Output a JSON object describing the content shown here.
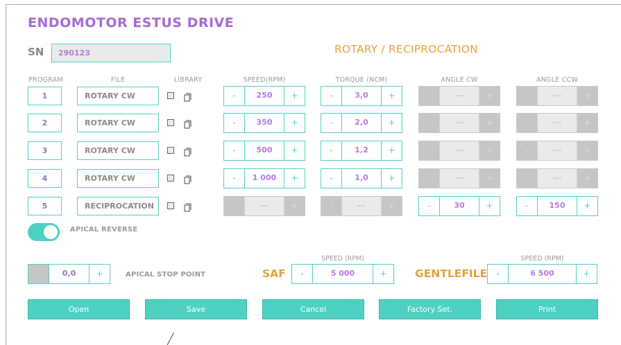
{
  "title": "ENDOMOTOR ESTUS DRIVE",
  "sn": {
    "label": "SN",
    "value": "290123"
  },
  "mode_title": "ROTARY / RECIPROCATION",
  "columns": {
    "program": "PROGRAM",
    "file": "FILE",
    "library": "LIBRARY",
    "speed": "SPEED(RPM)",
    "torque": "TORQUE (NCM)",
    "angle_cw": "ANGLE CW",
    "angle_ccw": "ANGLE CCW"
  },
  "stepper_minus": "-",
  "stepper_plus": "+",
  "programs": [
    {
      "num": "1",
      "file": "ROTARY CW",
      "speed": "250",
      "torque": "3,0",
      "angle_cw": "---",
      "angle_ccw": "---"
    },
    {
      "num": "2",
      "file": "ROTARY CW",
      "speed": "350",
      "torque": "2,0",
      "angle_cw": "---",
      "angle_ccw": "---"
    },
    {
      "num": "3",
      "file": "ROTARY CW",
      "speed": "500",
      "torque": "1,2",
      "angle_cw": "---",
      "angle_ccw": "---"
    },
    {
      "num": "4",
      "file": "ROTARY CW",
      "speed": "1 000",
      "torque": "1,0",
      "angle_cw": "---",
      "angle_ccw": "---"
    },
    {
      "num": "5",
      "file": "RECIPROCATION",
      "speed": "---",
      "torque": "---",
      "angle_cw": "30",
      "angle_ccw": "150"
    }
  ],
  "apical_reverse": {
    "label": "APICAL REVERSE",
    "on": true
  },
  "apical_stop": {
    "value": "0,0",
    "label": "APICAL STOP POINT"
  },
  "saf": {
    "label": "SAF",
    "speed_header": "SPEED (RPM)",
    "value": "5 000"
  },
  "gentlefile": {
    "label": "GENTLEFILE",
    "speed_header": "SPEED (RPM)",
    "value": "6 500"
  },
  "buttons": {
    "open": "Open",
    "save": "Save",
    "cancel": "Cancel",
    "factory": "Factory Set.",
    "print": "Print"
  },
  "colors": {
    "accent": "#4fd1c2",
    "title": "#a66ad6",
    "orange": "#e8a138"
  }
}
